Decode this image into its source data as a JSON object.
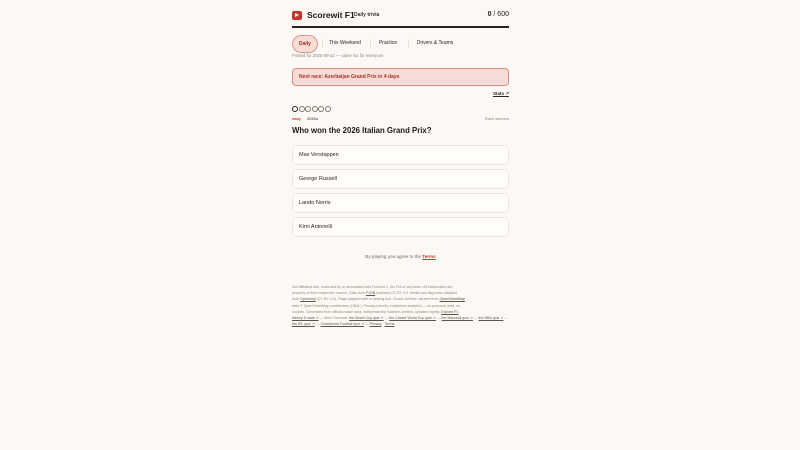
{
  "header": {
    "brand": "Scorewit F1",
    "subtitle": "Daily trivia",
    "score_value": "0",
    "score_total": "/ 600"
  },
  "tabs": [
    {
      "label": "Daily",
      "active": true
    },
    {
      "label": "This Weekend",
      "active": false
    },
    {
      "label": "Practice",
      "active": false
    },
    {
      "label": "Drivers & Teams",
      "active": false
    }
  ],
  "posted": "Posted for 2026-09-22 — same six for everyone",
  "banner": "Next race: Azerbaijan Grand Prix in 4 days",
  "stats_link": "Stats ↗",
  "progress": {
    "current": 1,
    "total": 6
  },
  "meta": {
    "difficulty": "easy",
    "era": "2020s",
    "category": "Race winners"
  },
  "question": "Who won the 2026 Italian Grand Prix?",
  "answers": [
    "Max Verstappen",
    "George Russell",
    "Lando Norris",
    "Kimi Antonelli"
  ],
  "terms": {
    "prefix": "By playing you agree to the",
    "link": "Terms"
  },
  "footer": {
    "line1": "Not affiliated with, endorsed by or associated with Formula 1, the FIA or any team. All trademarks are",
    "line2": "property of their respective owners. Data from",
    "line2_link": "F1DB",
    "line2b": "(various) CC BY 4.0. Medal and flag icons adapted",
    "line3": "from",
    "line3_link": "Openmoji",
    "line3b": "(CC BY 4.0). Flags adapted with a viewing fork. Circuit outlines: derived from",
    "line3_link2": "OpenStreetMap",
    "line4": "data © OpenStreetMap contributors (ODbL). Privacy-friendly, cookieless analytics — no personal data, no",
    "line5": "cookies. Generated from official match data, independently machine-verified, updated nightly.",
    "line5_link": "Explore F1",
    "line6_link": "history & stats ↗",
    "line6b": "— More Scorewit:",
    "more": [
      "the World Cup quiz ↗",
      "the Cricket World Cup quiz ↗",
      "the Baseball quiz ↗",
      "the NBA quiz ↗",
      "the IPL quiz ↗",
      "Champions Football quiz ↗"
    ],
    "privacy": "Privacy",
    "terms": "Terms"
  },
  "colors": {
    "accent": "#c7362b",
    "background": "#fcf9f4",
    "banner_bg": "#f6dcd6"
  }
}
